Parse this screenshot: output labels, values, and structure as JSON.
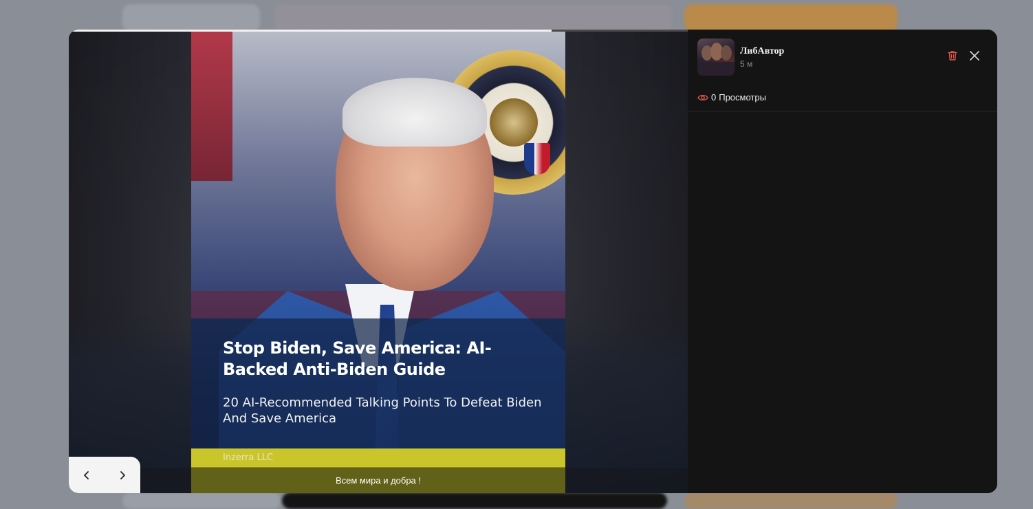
{
  "story": {
    "progress": 0.78,
    "caption": "Всем мира и добра !",
    "cover": {
      "title": "Stop Biden, Save America: AI-Backed Anti-Biden Guide",
      "subtitle": "20 AI-Recommended Talking Points To Defeat Biden And Save America",
      "publisher": "Inzerra LLC"
    }
  },
  "author": {
    "name": "ЛибАвтор",
    "time_ago": "5 м"
  },
  "stats": {
    "views_count": "0",
    "views_label": "Просмотры"
  },
  "icons": {
    "prev": "chevron-left-icon",
    "next": "chevron-right-icon",
    "delete": "trash-icon",
    "close": "close-icon",
    "views": "eye-icon"
  },
  "colors": {
    "modal_bg": "#141414",
    "delete_icon": "#e0574f",
    "nav_bg": "#f4f4f4"
  }
}
